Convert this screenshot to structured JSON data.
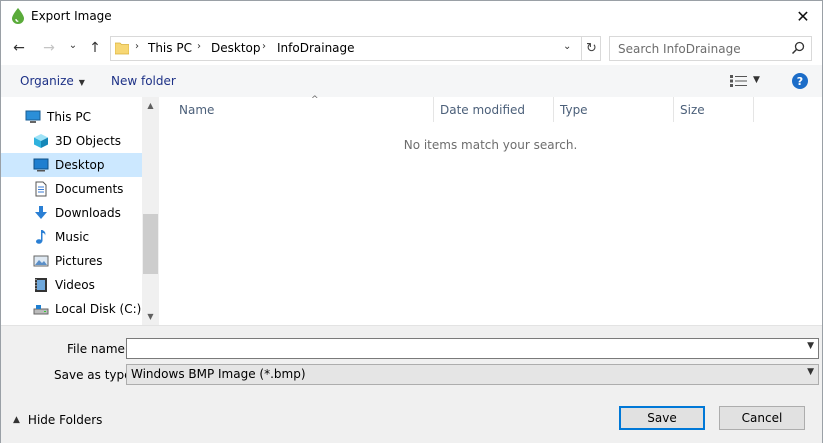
{
  "window": {
    "title": "Export Image",
    "close_glyph": "✕"
  },
  "nav": {
    "back_glyph": "←",
    "forward_glyph": "→",
    "recent_glyph": "⌄",
    "up_glyph": "↑",
    "breadcrumbs": [
      "This PC",
      "Desktop",
      "InfoDrainage"
    ],
    "separator": "›",
    "dropdown_glyph": "⌄",
    "refresh_glyph": "↻"
  },
  "search": {
    "placeholder": "Search InfoDrainage"
  },
  "toolbar": {
    "organize_label": "Organize",
    "new_folder_label": "New folder",
    "help_glyph": "?"
  },
  "sidebar": {
    "items": [
      {
        "label": "This PC",
        "icon": "computer-icon",
        "selected": false
      },
      {
        "label": "3D Objects",
        "icon": "cube-icon",
        "selected": false
      },
      {
        "label": "Desktop",
        "icon": "desktop-icon",
        "selected": true
      },
      {
        "label": "Documents",
        "icon": "document-icon",
        "selected": false
      },
      {
        "label": "Downloads",
        "icon": "download-icon",
        "selected": false
      },
      {
        "label": "Music",
        "icon": "music-icon",
        "selected": false
      },
      {
        "label": "Pictures",
        "icon": "pictures-icon",
        "selected": false
      },
      {
        "label": "Videos",
        "icon": "videos-icon",
        "selected": false
      },
      {
        "label": "Local Disk (C:)",
        "icon": "drive-icon",
        "selected": false
      }
    ]
  },
  "files": {
    "columns": [
      "Name",
      "Date modified",
      "Type",
      "Size"
    ],
    "empty_message": "No items match your search."
  },
  "form": {
    "file_name_label": "File name:",
    "file_name_value": "",
    "save_type_label": "Save as type:",
    "save_type_value": "Windows BMP Image (*.bmp)"
  },
  "footer": {
    "hide_folders_label": "Hide Folders",
    "save_label": "Save",
    "cancel_label": "Cancel"
  },
  "colors": {
    "selection": "#cce8ff",
    "accent": "#0078d7",
    "link": "#1e3287",
    "help": "#1c6dc8"
  }
}
